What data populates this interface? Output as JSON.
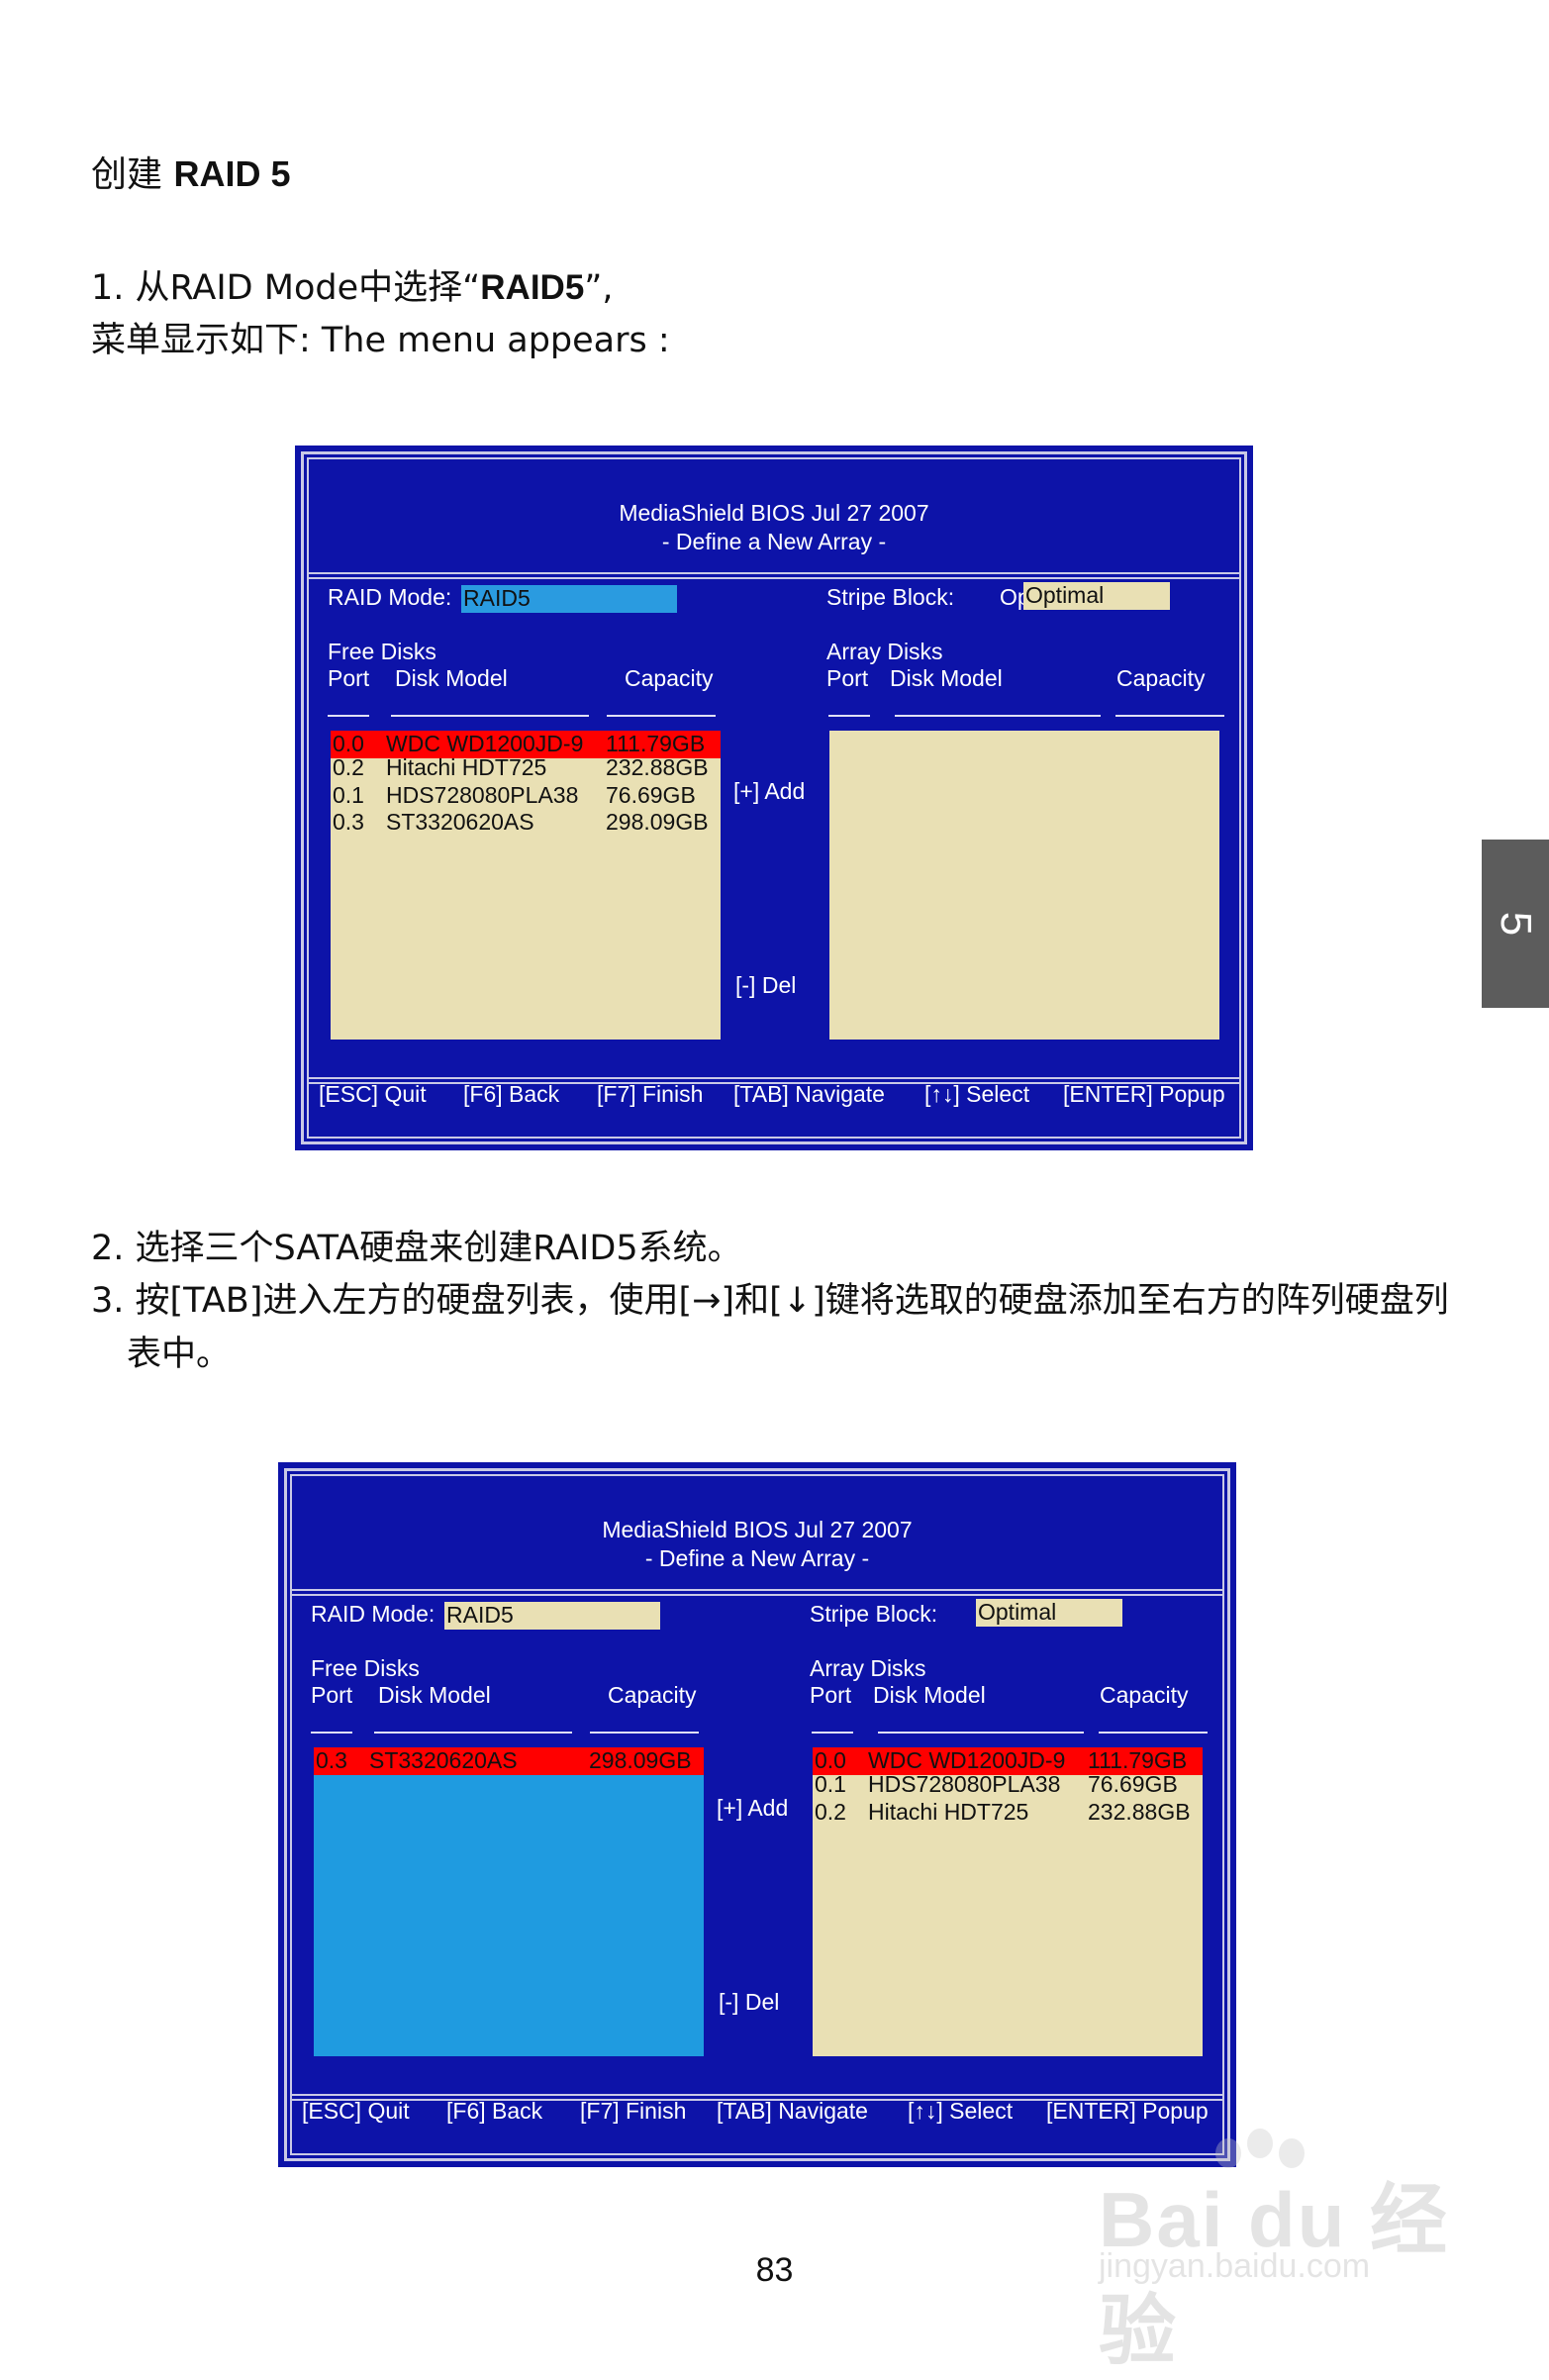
{
  "doc": {
    "heading_cn": "创建",
    "heading_en": "RAID 5",
    "step1_pre": "1. 从RAID Mode中选择“",
    "step1_bold": "RAID5",
    "step1_post": "”,",
    "step1_line2": "菜单显示如下: The menu appears :",
    "step2": "2. 选择三个SATA硬盘来创建RAID5系统。",
    "step3_line1": "3. 按[TAB]进入左方的硬盘列表，使用[→]和[↓]键将选取的硬盘添加至右方的阵列硬盘列",
    "step3_line2": "表中。",
    "side_tab": "5",
    "page_number": "83",
    "watermark_main": "Bai du 经验",
    "watermark_sub": "jingyan.baidu.com"
  },
  "screen1": {
    "title": "MediaShield BIOS   Jul 27 2007",
    "subtitle": "- Define a New Array -",
    "raid_mode_label": "RAID Mode:",
    "raid_mode_value": "RAID5",
    "stripe_label": "Stripe Block:",
    "stripe_overlap": "Op",
    "stripe_value": "Optimal",
    "free_disks": "Free Disks",
    "array_disks": "Array Disks",
    "col_port": "Port",
    "col_model": "Disk Model",
    "col_capacity": "Capacity",
    "add_label": "[+] Add",
    "del_label": "[-] Del",
    "free_rows": [
      {
        "port": "0.0",
        "model": "WDC WD1200JD-9",
        "cap": "111.79GB"
      },
      {
        "port": "0.2",
        "model": "Hitachi HDT725",
        "cap": "232.88GB"
      },
      {
        "port": "0.1",
        "model": "HDS728080PLA38",
        "cap": "76.69GB"
      },
      {
        "port": "0.3",
        "model": "ST3320620AS",
        "cap": "298.09GB"
      }
    ],
    "array_rows": [],
    "footer": [
      "[ESC] Quit",
      "[F6] Back",
      "[F7] Finish",
      "[TAB] Navigate",
      "[↑↓] Select",
      "[ENTER] Popup"
    ]
  },
  "screen2": {
    "title": "MediaShield BIOS   Jul 27 2007",
    "subtitle": "- Define a New Array -",
    "raid_mode_label": "RAID Mode:",
    "raid_mode_value": "RAID5",
    "stripe_label": "Stripe Block:",
    "stripe_value": "Optimal",
    "free_disks": "Free Disks",
    "array_disks": "Array Disks",
    "col_port": "Port",
    "col_model": "Disk Model",
    "col_capacity": "Capacity",
    "add_label": "[+] Add",
    "del_label": "[-] Del",
    "free_rows": [
      {
        "port": "0.3",
        "model": "ST3320620AS",
        "cap": "298.09GB"
      }
    ],
    "array_rows": [
      {
        "port": "0.0",
        "model": "WDC WD1200JD-9",
        "cap": "111.79GB"
      },
      {
        "port": "0.1",
        "model": "HDS728080PLA38",
        "cap": "76.69GB"
      },
      {
        "port": "0.2",
        "model": "Hitachi HDT725",
        "cap": "232.88GB"
      }
    ],
    "footer": [
      "[ESC] Quit",
      "[F6] Back",
      "[F7] Finish",
      "[TAB] Navigate",
      "[↑↓] Select",
      "[ENTER] Popup"
    ]
  }
}
